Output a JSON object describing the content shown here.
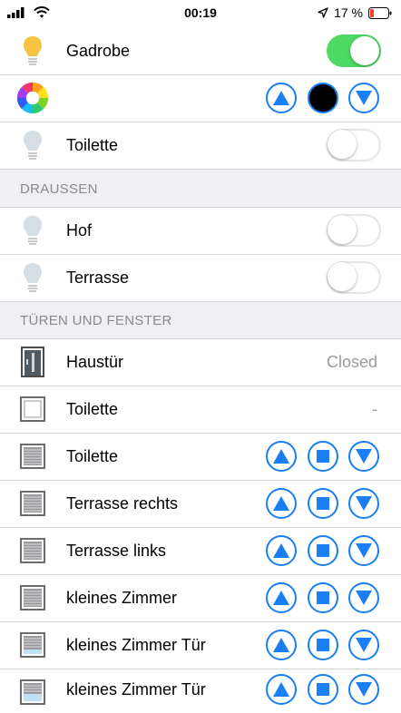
{
  "status": {
    "time": "00:19",
    "battery": "17 %",
    "colors": {
      "battery_low": "#ff3b30"
    },
    "icons": [
      "signal-icon",
      "wifi-icon",
      "location-arrow-icon",
      "battery-icon"
    ]
  },
  "colors": {
    "accent": "#1a7ef5",
    "switch_on": "#4cd964",
    "section_bg": "#efeff4",
    "section_text": "#8a8a8f",
    "value_text": "#9b9b9f",
    "bulb_on": "#f6c342",
    "bulb_off": "#d4dee3"
  },
  "rows_top": [
    {
      "label": "Gadrobe",
      "icon": "lightbulb-on-icon",
      "control": "switch",
      "on": true
    },
    {
      "label": "",
      "icon": "color-wheel-icon",
      "control": "color-updown",
      "color": "#000000"
    },
    {
      "label": "Toilette",
      "icon": "lightbulb-off-icon",
      "control": "switch",
      "on": false
    }
  ],
  "section_draussen": {
    "title": "DRAUSSEN",
    "rows": [
      {
        "label": "Hof",
        "icon": "lightbulb-off-icon",
        "control": "switch",
        "on": false
      },
      {
        "label": "Terrasse",
        "icon": "lightbulb-off-icon",
        "control": "switch",
        "on": false
      }
    ]
  },
  "section_tueren": {
    "title": "TÜREN UND FENSTER",
    "rows": [
      {
        "label": "Haustür",
        "icon": "door-icon",
        "control": "value",
        "value": "Closed"
      },
      {
        "label": "Toilette",
        "icon": "window-icon",
        "control": "value",
        "value": "-"
      },
      {
        "label": "Toilette",
        "icon": "shutter-icon",
        "control": "updown"
      },
      {
        "label": "Terrasse rechts",
        "icon": "shutter-icon",
        "control": "updown"
      },
      {
        "label": "Terrasse links",
        "icon": "shutter-icon",
        "control": "updown"
      },
      {
        "label": "kleines Zimmer",
        "icon": "shutter-icon",
        "control": "updown"
      },
      {
        "label": "kleines Zimmer Tür",
        "icon": "shutter-open-icon",
        "control": "updown"
      },
      {
        "label": "kleines Zimmer Tür",
        "icon": "shutter-open-icon",
        "control": "updown"
      }
    ]
  }
}
